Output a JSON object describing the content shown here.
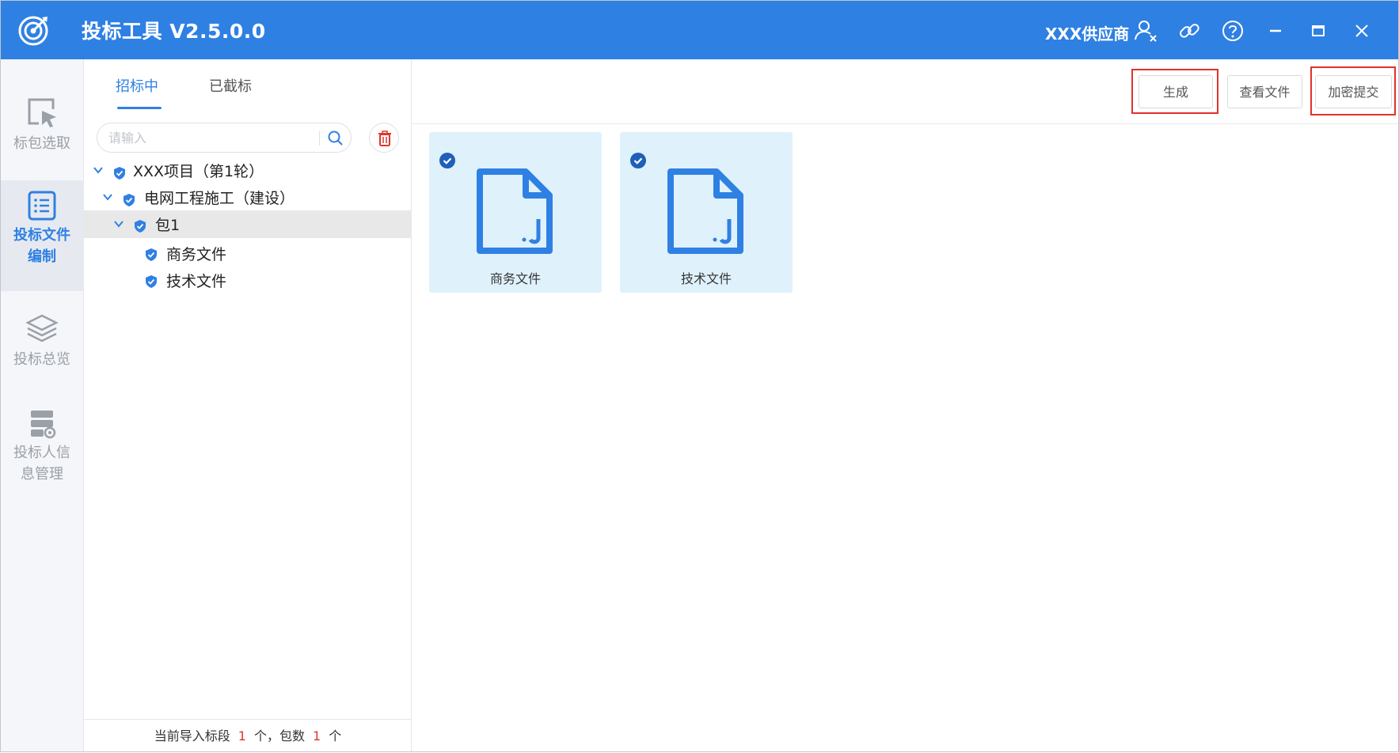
{
  "window": {
    "title": "投标工具  V2.5.0.0",
    "supplier": "XXX供应商",
    "accent_color": "#2f80e3",
    "controls": [
      "user-switch-icon",
      "link-icon",
      "help-icon",
      "minimize-icon",
      "maximize-icon",
      "close-icon"
    ]
  },
  "nav": {
    "items": [
      {
        "label": "标包选取",
        "icon": "cursor-select-icon"
      },
      {
        "label": "投标文件编制",
        "icon": "document-list-icon",
        "active": true
      },
      {
        "label": "投标总览",
        "icon": "layers-icon"
      },
      {
        "label": "投标人信息管理",
        "icon": "server-settings-icon"
      }
    ]
  },
  "tree_panel": {
    "tabs": [
      {
        "label": "招标中",
        "active": true
      },
      {
        "label": "已截标"
      }
    ],
    "search_placeholder": "请输入",
    "tree": [
      {
        "label": "XXX项目（第1轮）",
        "level": 0,
        "expanded": true
      },
      {
        "label": "电网工程施工（建设）",
        "level": 1,
        "expanded": true
      },
      {
        "label": "包1",
        "level": 2,
        "expanded": true,
        "selected": true
      },
      {
        "label": "商务文件",
        "level": 3
      },
      {
        "label": "技术文件",
        "level": 3
      }
    ],
    "status": {
      "prefix": "当前导入标段",
      "sections": "1",
      "middle": "个，包数",
      "packages": "1",
      "suffix": "个"
    }
  },
  "toolbar": {
    "generate": "生成",
    "view_files": "查看文件",
    "encrypt_submit": "加密提交",
    "highlight_color": "#e0322b"
  },
  "files": [
    {
      "name": "商务文件",
      "checked": true,
      "icon": "document-icon"
    },
    {
      "name": "技术文件",
      "checked": true,
      "icon": "document-icon"
    }
  ]
}
